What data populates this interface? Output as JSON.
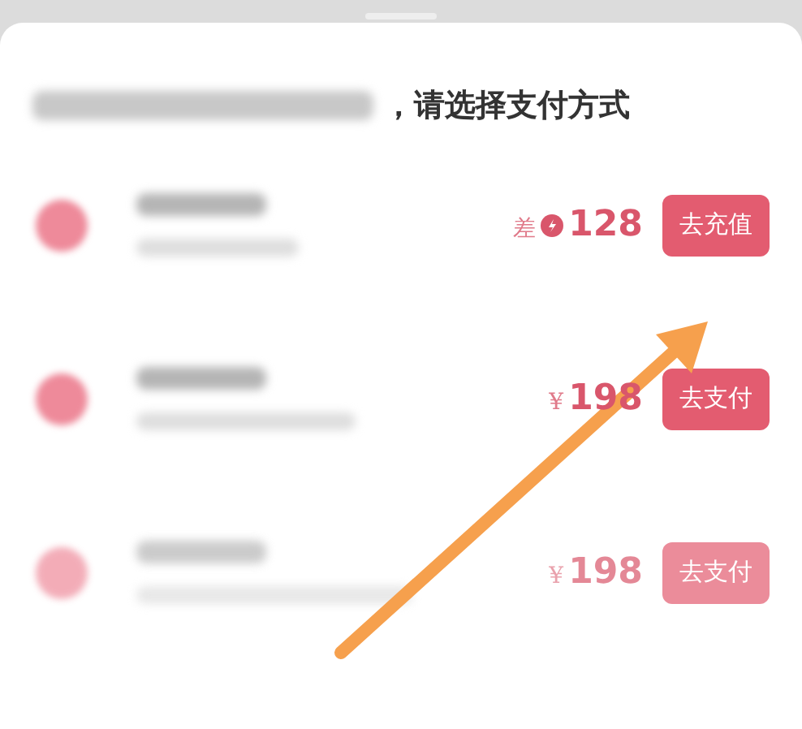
{
  "sheet": {
    "title": "，请选择支付方式"
  },
  "options": [
    {
      "kind": "recharge",
      "prefix": "差",
      "amount": "128",
      "button": "去充值",
      "disabled": false
    },
    {
      "kind": "pay",
      "prefix": "¥",
      "amount": "198",
      "button": "去支付",
      "disabled": false
    },
    {
      "kind": "pay",
      "prefix": "¥",
      "amount": "198",
      "button": "去支付",
      "disabled": true
    }
  ]
}
